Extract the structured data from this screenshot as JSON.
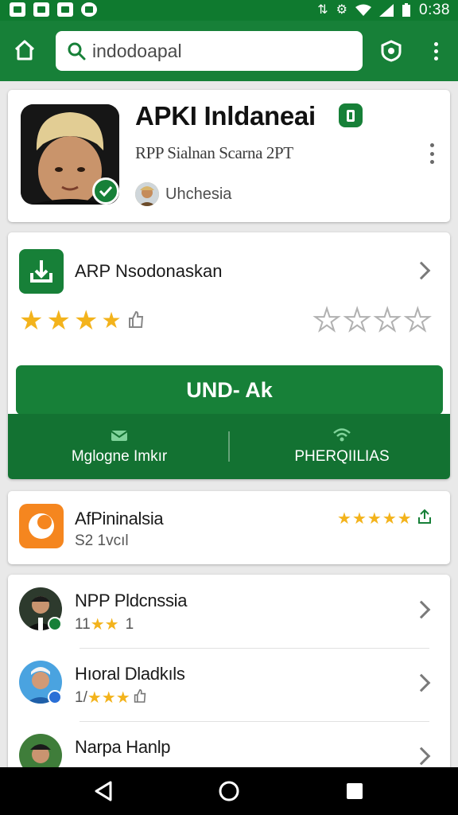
{
  "status_bar": {
    "time": "0:38",
    "icons": [
      "gallery-icon",
      "image-icon",
      "shield-icon",
      "messenger-icon",
      "vibrate-icon",
      "sync-icon",
      "wifi-icon",
      "signal-icon",
      "battery-icon"
    ]
  },
  "search": {
    "value": "indodoapal"
  },
  "app_header": {
    "title": "APKI Inldaneai",
    "subtitle": "RPP Sialnan Scarna 2PT",
    "developer": "Uhchesia"
  },
  "install_card": {
    "package_name": "ARP Nsodonaskan",
    "rating_stars": 3.5,
    "install_label": "UND- Ak",
    "actions": [
      {
        "label": "Mglogne Imkır",
        "icon": "mail-icon"
      },
      {
        "label": "PHERQIILIAS",
        "icon": "wifi-icon"
      }
    ]
  },
  "featured_app": {
    "title": "AfPininalsia",
    "subtitle": "S2 1vcıl",
    "rating_stars": 5
  },
  "app_list": [
    {
      "title": "NPP Pldcnssia",
      "rating_prefix": "11",
      "rating_suffix": "1"
    },
    {
      "title": "Hıoral Dladkıls",
      "rating_prefix": "1/",
      "rating_suffix": ""
    },
    {
      "title": "Narpa Hanlp",
      "rating_prefix": "",
      "rating_suffix": ""
    }
  ],
  "colors": {
    "primary_green": "#178038",
    "dark_green": "#137232",
    "star_yellow": "#f3b31c",
    "orange": "#f5861f"
  }
}
